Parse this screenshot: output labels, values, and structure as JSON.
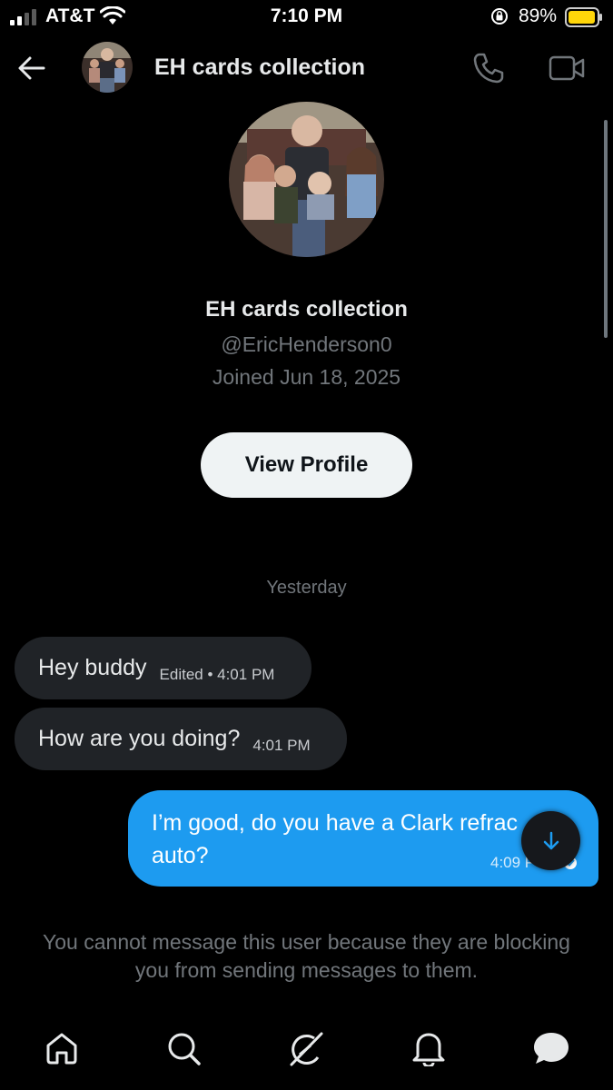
{
  "status_bar": {
    "carrier": "AT&T",
    "time": "7:10 PM",
    "battery": "89%",
    "icons": [
      "signal-icon",
      "wifi-icon",
      "rotation-lock-icon",
      "battery-icon"
    ]
  },
  "header": {
    "title": "EH cards collection",
    "icons": [
      "back-arrow-icon",
      "phone-icon",
      "video-icon"
    ]
  },
  "profile": {
    "name": "EH cards collection",
    "handle": "@EricHenderson0",
    "joined": "Joined Jun 18, 2025",
    "view_profile_label": "View Profile"
  },
  "conversation": {
    "day_separator": "Yesterday",
    "messages": [
      {
        "text": "Hey buddy",
        "meta": "Edited • 4:01 PM",
        "direction": "incoming"
      },
      {
        "text": "How are you doing?",
        "meta": "4:01 PM",
        "direction": "incoming"
      },
      {
        "text": "I’m good, do you have a Clark refrac\nauto?",
        "meta": "4:09 P",
        "direction": "outgoing"
      }
    ],
    "blocked_notice": "You cannot message this user because they are blocking you from sending messages to them."
  },
  "bottom_nav": [
    "home-icon",
    "search-icon",
    "grok-icon",
    "notifications-icon",
    "messages-icon"
  ],
  "colors": {
    "accent": "#1d9bf0",
    "background": "#000000",
    "bubble_incoming": "#202327",
    "muted_text": "#71767b"
  }
}
